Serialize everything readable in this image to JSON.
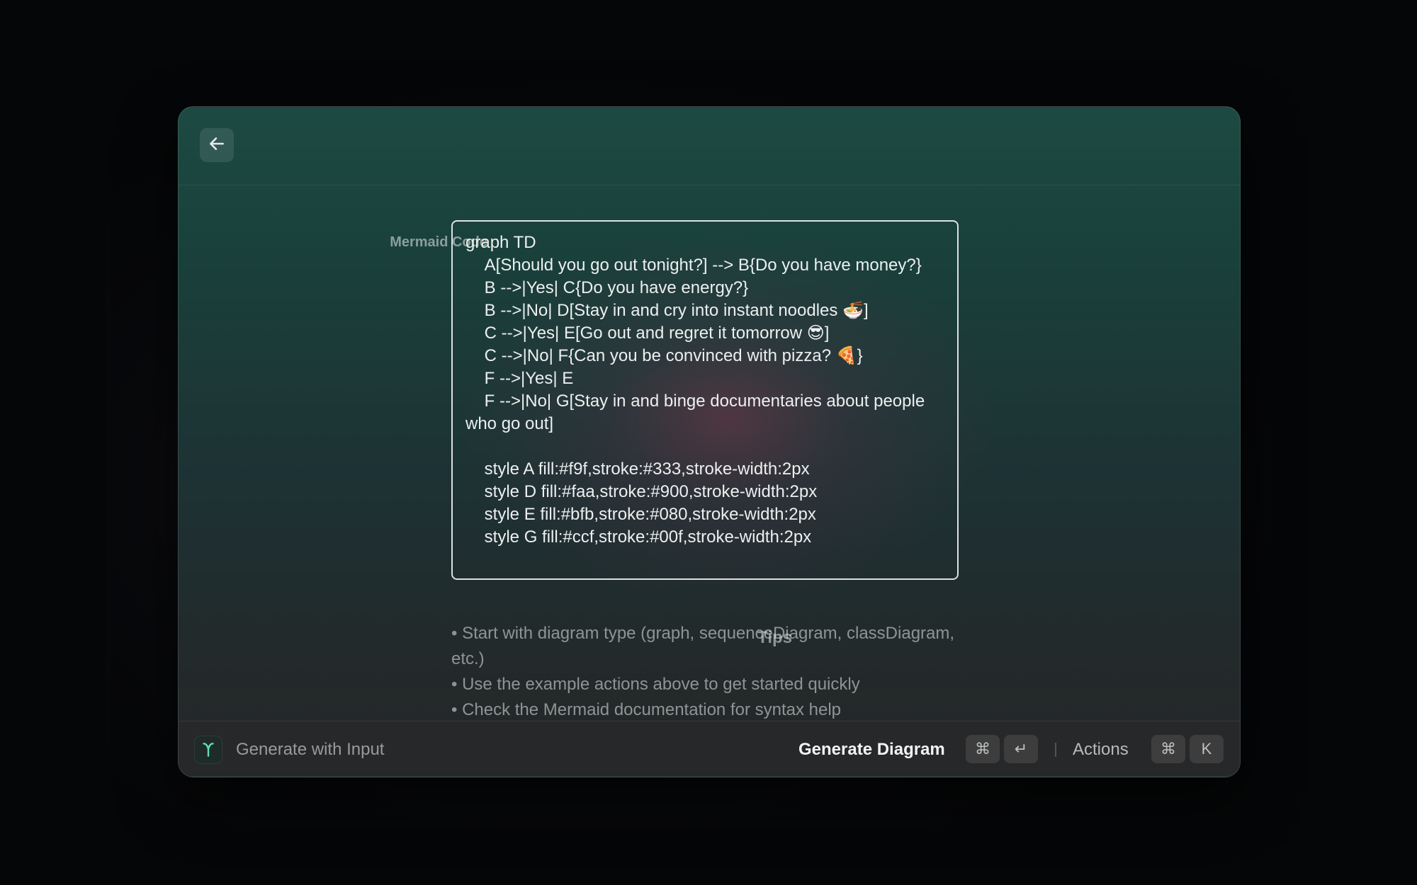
{
  "form": {
    "code_label": "Mermaid Code",
    "code_value": "graph TD\n    A[Should you go out tonight?] --> B{Do you have money?}\n    B -->|Yes| C{Do you have energy?}\n    B -->|No| D[Stay in and cry into instant noodles 🍜]\n    C -->|Yes| E[Go out and regret it tomorrow 😎]\n    C -->|No| F{Can you be convinced with pizza? 🍕}\n    F -->|Yes| E\n    F -->|No| G[Stay in and binge documentaries about people who go out]\n\n    style A fill:#f9f,stroke:#333,stroke-width:2px\n    style D fill:#faa,stroke:#900,stroke-width:2px\n    style E fill:#bfb,stroke:#080,stroke-width:2px\n    style G fill:#ccf,stroke:#00f,stroke-width:2px",
    "tips_label": "Tips",
    "tips": [
      "• Start with diagram type (graph, sequenceDiagram, classDiagram, etc.)",
      "• Use the example actions above to get started quickly",
      "• Check the Mermaid documentation for syntax help"
    ]
  },
  "footer": {
    "command_title": "Generate with Input",
    "primary_action": "Generate Diagram",
    "primary_shortcut": [
      "⌘",
      "↵"
    ],
    "secondary_action": "Actions",
    "secondary_shortcut": [
      "⌘",
      "K"
    ]
  },
  "icons": {
    "back": "arrow-left-icon",
    "app": "mermaid-app-icon"
  },
  "colors": {
    "accent": "#5fe0b8",
    "window_top": "#1c4a42",
    "footer_bg": "#272829"
  }
}
